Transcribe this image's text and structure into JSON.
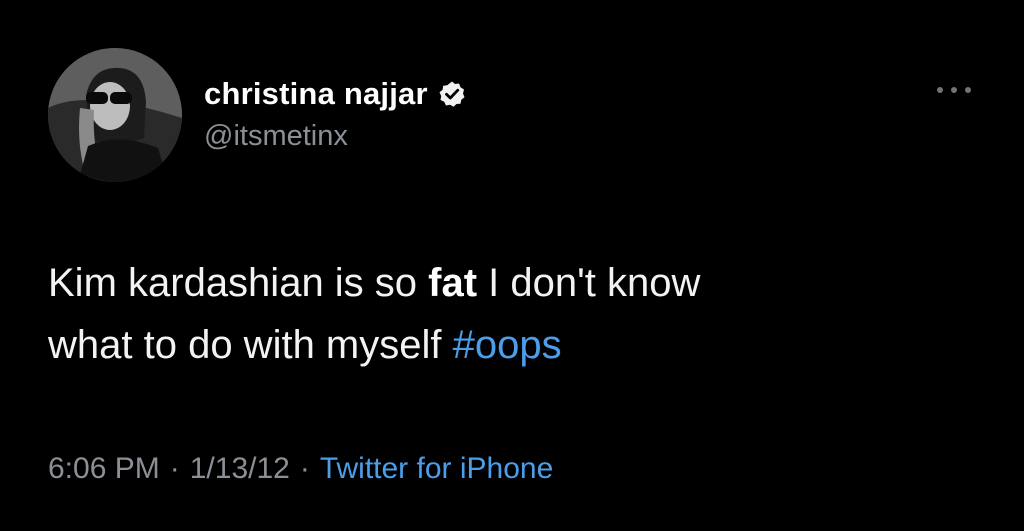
{
  "user": {
    "display_name": "christina najjar",
    "handle": "@itsmetinx",
    "verified_icon": "verified-badge-icon",
    "avatar": "profile-photo"
  },
  "tweet": {
    "text_part1": "Kim kardashian is so ",
    "text_bold": "fat",
    "text_part2": " I don't know",
    "text_line2": "what to do with myself ",
    "hashtag": "#oops"
  },
  "meta": {
    "time": "6:06 PM",
    "separator": "·",
    "date": "1/13/12",
    "source": "Twitter for iPhone"
  },
  "menu": {
    "icon": "more-options-icon"
  },
  "colors": {
    "background": "#000000",
    "text": "#e7e9ea",
    "secondary": "#8b9096",
    "link": "#4a9eea"
  }
}
